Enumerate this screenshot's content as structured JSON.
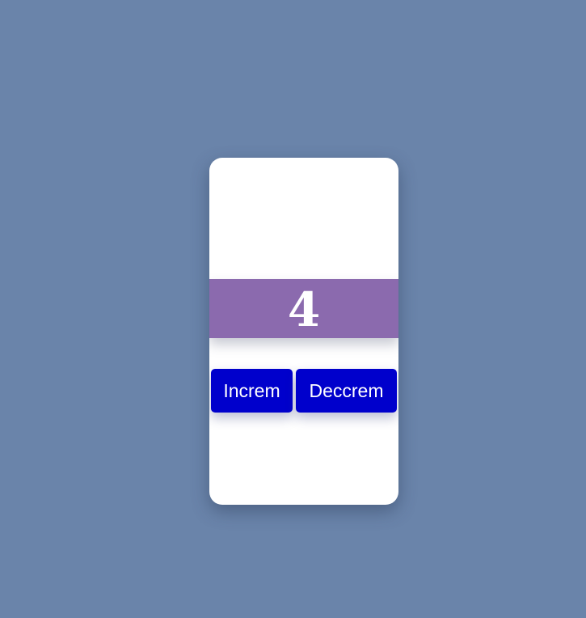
{
  "counter": {
    "value": "4"
  },
  "buttons": {
    "increment_label": "Increm",
    "decrement_label": "Deccrem"
  },
  "colors": {
    "background": "#6a84aa",
    "card": "#ffffff",
    "counter_band": "#8b6aae",
    "button": "#0000cc",
    "button_text": "#ffffff"
  }
}
